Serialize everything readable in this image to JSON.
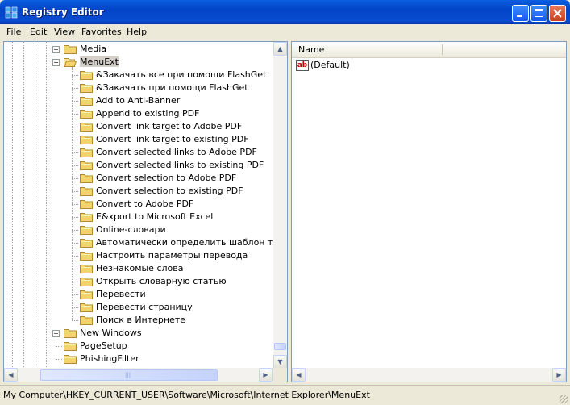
{
  "window": {
    "title": "Registry Editor",
    "icon": "regedit-icon",
    "controls": [
      "minimize",
      "maximize",
      "close"
    ]
  },
  "menu": [
    "File",
    "Edit",
    "View",
    "Favorites",
    "Help"
  ],
  "tree": {
    "items": [
      {
        "label": "Media",
        "expander": "+",
        "selected": false
      },
      {
        "label": "MenuExt",
        "expander": "-",
        "selected": true
      },
      {
        "label": "&Закачать все при помощи FlashGet",
        "expander": "",
        "selected": false
      },
      {
        "label": "&Закачать при помощи FlashGet",
        "expander": "",
        "selected": false
      },
      {
        "label": "Add to Anti-Banner",
        "expander": "",
        "selected": false
      },
      {
        "label": "Append to existing PDF",
        "expander": "",
        "selected": false
      },
      {
        "label": "Convert link target to Adobe PDF",
        "expander": "",
        "selected": false
      },
      {
        "label": "Convert link target to existing PDF",
        "expander": "",
        "selected": false
      },
      {
        "label": "Convert selected links to Adobe PDF",
        "expander": "",
        "selected": false
      },
      {
        "label": "Convert selected links to existing PDF",
        "expander": "",
        "selected": false
      },
      {
        "label": "Convert selection to Adobe PDF",
        "expander": "",
        "selected": false
      },
      {
        "label": "Convert selection to existing PDF",
        "expander": "",
        "selected": false
      },
      {
        "label": "Convert to Adobe PDF",
        "expander": "",
        "selected": false
      },
      {
        "label": "E&xport to Microsoft Excel",
        "expander": "",
        "selected": false
      },
      {
        "label": "Online-словари",
        "expander": "",
        "selected": false
      },
      {
        "label": "Автоматически определить шаблон темати",
        "expander": "",
        "selected": false
      },
      {
        "label": "Настроить параметры перевода",
        "expander": "",
        "selected": false
      },
      {
        "label": "Незнакомые слова",
        "expander": "",
        "selected": false
      },
      {
        "label": "Открыть словарную статью",
        "expander": "",
        "selected": false
      },
      {
        "label": "Перевести",
        "expander": "",
        "selected": false
      },
      {
        "label": "Перевести страницу",
        "expander": "",
        "selected": false
      },
      {
        "label": "Поиск в Интернете",
        "expander": "",
        "selected": false
      },
      {
        "label": "New Windows",
        "expander": "+",
        "selected": false
      },
      {
        "label": "PageSetup",
        "expander": "",
        "selected": false
      },
      {
        "label": "PhishingFilter",
        "expander": "",
        "selected": false
      }
    ]
  },
  "values_pane": {
    "column_name": "Name",
    "rows": [
      {
        "name": "(Default)",
        "icon": "string-value-icon",
        "icon_text": "ab"
      }
    ]
  },
  "status": {
    "path": "My Computer\\HKEY_CURRENT_USER\\Software\\Microsoft\\Internet Explorer\\MenuExt"
  },
  "colors": {
    "title_bar": "#0a4cd0",
    "close_button": "#c8401e",
    "window_bg": "#ece9d8",
    "folder_yellow": "#f4d36a"
  }
}
